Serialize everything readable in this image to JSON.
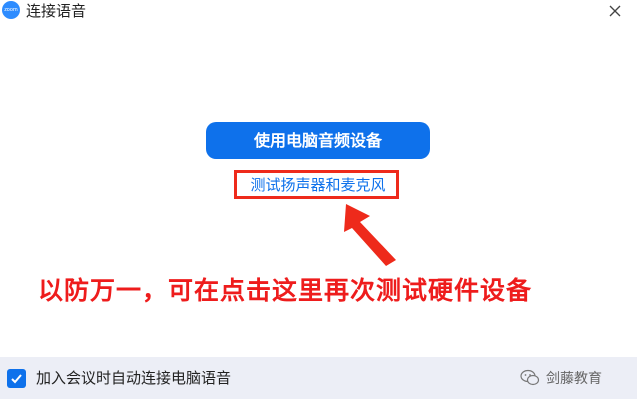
{
  "window": {
    "title": "连接语音",
    "logo_text": "zoom",
    "close_icon": "close-icon"
  },
  "main": {
    "primary_button_label": "使用电脑音频设备",
    "test_link_label": "测试扬声器和麦克风"
  },
  "annotation": {
    "text": "以防万一，可在点击这里再次测试硬件设备",
    "color": "#ee1c1c"
  },
  "footer": {
    "auto_join_checked": true,
    "auto_join_label": "加入会议时自动连接电脑语音"
  },
  "watermark": {
    "text": "剑藤教育",
    "icon": "wechat-icon"
  },
  "colors": {
    "accent": "#0e71eb",
    "annotation_red": "#ee2a1b",
    "footer_bg": "#eceef6"
  }
}
